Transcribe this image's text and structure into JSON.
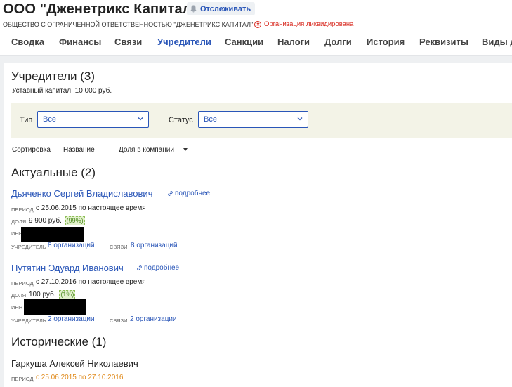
{
  "header": {
    "title": "ООО \"Дженетрикс Капитал\"",
    "track_label": "Отслеживать",
    "legal_name": "ОБЩЕСТВО С ОГРАНИЧЕННОЙ ОТВЕТСТВЕННОСТЬЮ \"ДЖЕНЕТРИКС КАПИТАЛ\"",
    "status": "Организация ликвидирована"
  },
  "tabs": [
    "Сводка",
    "Финансы",
    "Связи",
    "Учредители",
    "Санкции",
    "Налоги",
    "Долги",
    "История",
    "Реквизиты",
    "Виды д"
  ],
  "founders": {
    "title": "Учредители (3)",
    "capital": "Уставный капитал: 10 000 руб."
  },
  "filters": {
    "type_label": "Тип",
    "type_value": "Все",
    "status_label": "Статус",
    "status_value": "Все"
  },
  "sort": {
    "label": "Сортировка",
    "by_name": "Название",
    "by_share": "Доля в компании"
  },
  "labels": {
    "period": "период",
    "share": "доля",
    "inn": "инн",
    "founder": "учредитель",
    "links": "связи",
    "more": "подробнее"
  },
  "current": {
    "title": "Актуальные (2)",
    "people": [
      {
        "name": "Дьяченко Сергей Владиславович",
        "period": "с 25.06.2015 по настоящее время",
        "share": "9 900 руб.",
        "share_pct": "(99%)",
        "founder_of": "8 организаций",
        "links": "8 организаций"
      },
      {
        "name": "Путятин Эдуард Иванович",
        "period": "с 27.10.2016 по настоящее время",
        "share": "100 руб.",
        "share_pct": "(1%)",
        "founder_of": "2 организации",
        "links": "2 организации"
      }
    ]
  },
  "historical": {
    "title": "Исторические (1)",
    "people": [
      {
        "name": "Гаркуша Алексей Николаевич",
        "period": "с 25.06.2015 по 27.10.2016"
      }
    ]
  },
  "colors": {
    "accent": "#2a56b8",
    "danger": "#d8281e",
    "filter_bg": "#f3f3e7",
    "share_badge": "#e3f1cd",
    "historic_period": "#e08a1b"
  }
}
